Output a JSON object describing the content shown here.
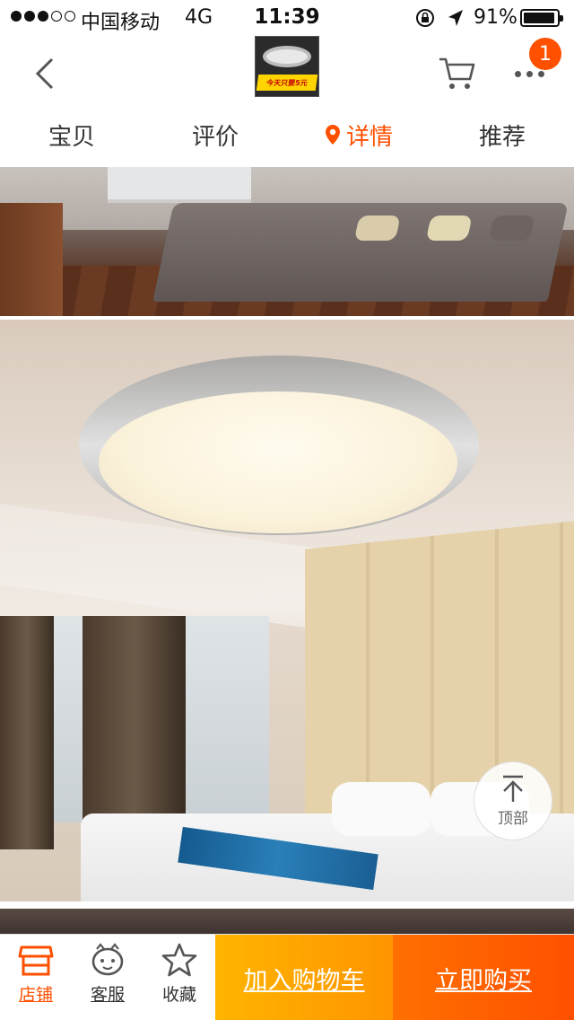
{
  "status_bar": {
    "carrier": "中国移动",
    "network": "4G",
    "time": "11:39",
    "battery_percent": "91%",
    "battery_level": 0.91
  },
  "nav": {
    "thumbnail_promo_text": "今天只要5元",
    "more_badge_count": "1",
    "accent_color": "#ff5000"
  },
  "tabs": [
    {
      "label": "宝贝",
      "active": false
    },
    {
      "label": "评价",
      "active": false
    },
    {
      "label": "详情",
      "active": true
    },
    {
      "label": "推荐",
      "active": false
    }
  ],
  "floating": {
    "back_to_top_label": "顶部"
  },
  "bottom_bar": {
    "items": [
      {
        "label": "店铺",
        "icon": "shop-icon",
        "active": true
      },
      {
        "label": "客服",
        "icon": "service-icon",
        "active": false
      },
      {
        "label": "收藏",
        "icon": "star-icon",
        "active": false
      }
    ],
    "add_to_cart_label": "加入购物车",
    "buy_now_label": "立即购买"
  }
}
